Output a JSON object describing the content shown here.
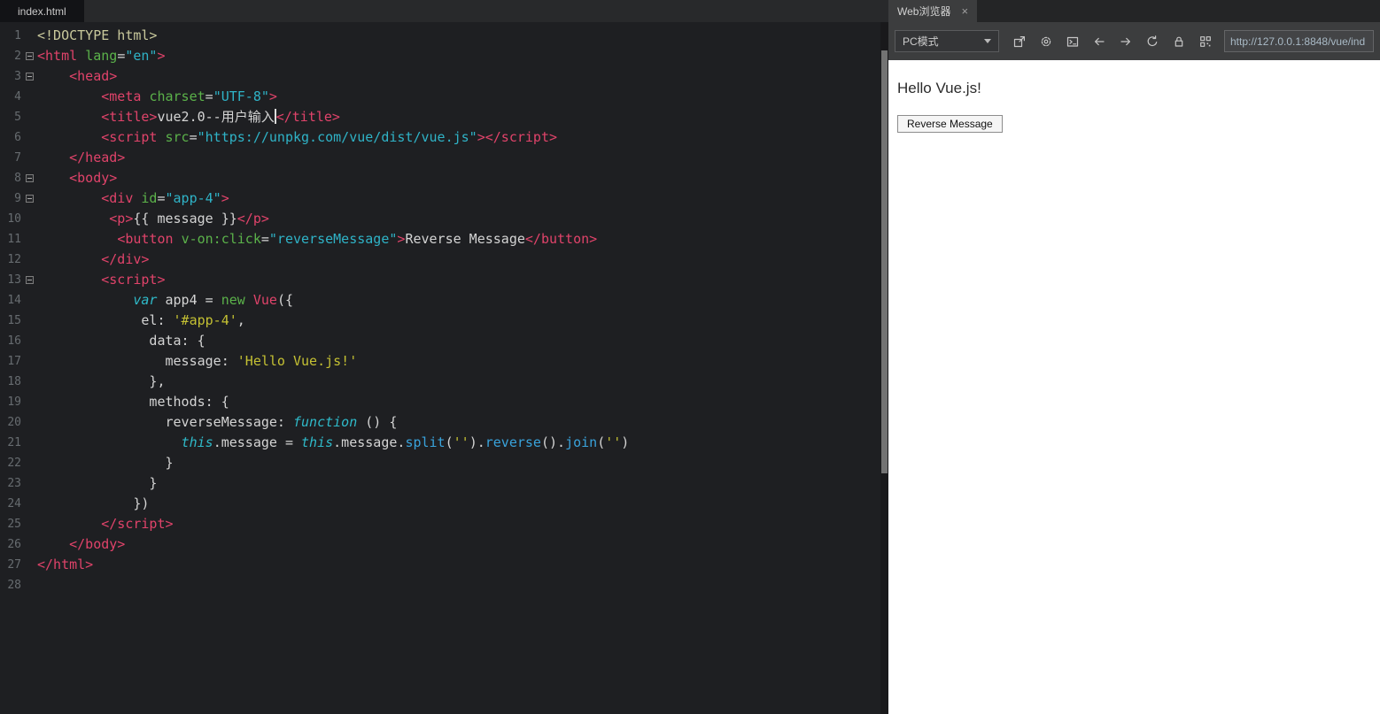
{
  "editor": {
    "tab_label": "index.html",
    "lines": [
      {
        "n": 1,
        "fold": false,
        "tokens": [
          [
            "d",
            "<!DOCTYPE html>"
          ]
        ]
      },
      {
        "n": 2,
        "fold": true,
        "tokens": [
          [
            "t",
            "<html"
          ],
          [
            "p",
            " "
          ],
          [
            "a",
            "lang"
          ],
          [
            "p",
            "="
          ],
          [
            "v",
            "\"en\""
          ],
          [
            "t",
            ">"
          ]
        ]
      },
      {
        "n": 3,
        "fold": true,
        "tokens": [
          [
            "p",
            "    "
          ],
          [
            "t",
            "<head>"
          ]
        ]
      },
      {
        "n": 4,
        "fold": false,
        "tokens": [
          [
            "p",
            "        "
          ],
          [
            "t",
            "<meta"
          ],
          [
            "p",
            " "
          ],
          [
            "a",
            "charset"
          ],
          [
            "p",
            "="
          ],
          [
            "v",
            "\"UTF-8\""
          ],
          [
            "t",
            ">"
          ]
        ]
      },
      {
        "n": 5,
        "fold": false,
        "tokens": [
          [
            "p",
            "        "
          ],
          [
            "t",
            "<title>"
          ],
          [
            "p",
            "vue2.0--用户输入"
          ],
          [
            "c",
            ""
          ],
          [
            "t",
            "</title>"
          ]
        ]
      },
      {
        "n": 6,
        "fold": false,
        "tokens": [
          [
            "p",
            "        "
          ],
          [
            "t",
            "<script"
          ],
          [
            "p",
            " "
          ],
          [
            "a",
            "src"
          ],
          [
            "p",
            "="
          ],
          [
            "v",
            "\"https://unpkg.com/vue/dist/vue.js\""
          ],
          [
            "t",
            "></script>"
          ]
        ]
      },
      {
        "n": 7,
        "fold": false,
        "tokens": [
          [
            "p",
            "    "
          ],
          [
            "t",
            "</head>"
          ]
        ]
      },
      {
        "n": 8,
        "fold": true,
        "tokens": [
          [
            "p",
            "    "
          ],
          [
            "t",
            "<body>"
          ]
        ]
      },
      {
        "n": 9,
        "fold": true,
        "tokens": [
          [
            "p",
            "        "
          ],
          [
            "t",
            "<div"
          ],
          [
            "p",
            " "
          ],
          [
            "a",
            "id"
          ],
          [
            "p",
            "="
          ],
          [
            "v",
            "\"app-4\""
          ],
          [
            "t",
            ">"
          ]
        ]
      },
      {
        "n": 10,
        "fold": false,
        "tokens": [
          [
            "p",
            "         "
          ],
          [
            "t",
            "<p>"
          ],
          [
            "p",
            "{{ message }}"
          ],
          [
            "t",
            "</p>"
          ]
        ]
      },
      {
        "n": 11,
        "fold": false,
        "tokens": [
          [
            "p",
            "          "
          ],
          [
            "t",
            "<button"
          ],
          [
            "p",
            " "
          ],
          [
            "a",
            "v-on:click"
          ],
          [
            "p",
            "="
          ],
          [
            "v",
            "\"reverseMessage\""
          ],
          [
            "t",
            ">"
          ],
          [
            "p",
            "Reverse Message"
          ],
          [
            "t",
            "</button>"
          ]
        ]
      },
      {
        "n": 12,
        "fold": false,
        "tokens": [
          [
            "p",
            "        "
          ],
          [
            "t",
            "</div>"
          ]
        ]
      },
      {
        "n": 13,
        "fold": true,
        "tokens": [
          [
            "p",
            "        "
          ],
          [
            "t",
            "<script>"
          ]
        ]
      },
      {
        "n": 14,
        "fold": false,
        "tokens": [
          [
            "p",
            "            "
          ],
          [
            "k",
            "var"
          ],
          [
            "p",
            " app4 = "
          ],
          [
            "n",
            "new"
          ],
          [
            "p",
            " "
          ],
          [
            "t",
            "Vue"
          ],
          [
            "p",
            "({"
          ]
        ]
      },
      {
        "n": 15,
        "fold": false,
        "tokens": [
          [
            "p",
            "             el: "
          ],
          [
            "s",
            "'#app-4'"
          ],
          [
            "p",
            ","
          ]
        ]
      },
      {
        "n": 16,
        "fold": false,
        "tokens": [
          [
            "p",
            "              data: {"
          ]
        ]
      },
      {
        "n": 17,
        "fold": false,
        "tokens": [
          [
            "p",
            "                message: "
          ],
          [
            "s",
            "'Hello Vue.js!'"
          ]
        ]
      },
      {
        "n": 18,
        "fold": false,
        "tokens": [
          [
            "p",
            "              },"
          ]
        ]
      },
      {
        "n": 19,
        "fold": false,
        "tokens": [
          [
            "p",
            "              methods: {"
          ]
        ]
      },
      {
        "n": 20,
        "fold": false,
        "tokens": [
          [
            "p",
            "                reverseMessage: "
          ],
          [
            "k",
            "function"
          ],
          [
            "p",
            " () {"
          ]
        ]
      },
      {
        "n": 21,
        "fold": false,
        "tokens": [
          [
            "p",
            "                  "
          ],
          [
            "k",
            "this"
          ],
          [
            "p",
            ".message = "
          ],
          [
            "k",
            "this"
          ],
          [
            "p",
            ".message."
          ],
          [
            "f",
            "split"
          ],
          [
            "p",
            "("
          ],
          [
            "s",
            "''"
          ],
          [
            "p",
            ")."
          ],
          [
            "f",
            "reverse"
          ],
          [
            "p",
            "()."
          ],
          [
            "f",
            "join"
          ],
          [
            "p",
            "("
          ],
          [
            "s",
            "''"
          ],
          [
            "p",
            ")"
          ]
        ]
      },
      {
        "n": 22,
        "fold": false,
        "tokens": [
          [
            "p",
            "                }"
          ]
        ]
      },
      {
        "n": 23,
        "fold": false,
        "tokens": [
          [
            "p",
            "              }"
          ]
        ]
      },
      {
        "n": 24,
        "fold": false,
        "tokens": [
          [
            "p",
            "            })"
          ]
        ]
      },
      {
        "n": 25,
        "fold": false,
        "tokens": [
          [
            "p",
            "        "
          ],
          [
            "t",
            "</script>"
          ]
        ]
      },
      {
        "n": 26,
        "fold": false,
        "tokens": [
          [
            "p",
            "    "
          ],
          [
            "t",
            "</body>"
          ]
        ]
      },
      {
        "n": 27,
        "fold": false,
        "tokens": [
          [
            "t",
            "</html>"
          ]
        ]
      },
      {
        "n": 28,
        "fold": false,
        "tokens": []
      }
    ]
  },
  "browser": {
    "tab_label": "Web浏览器",
    "close_glyph": "×",
    "mode_label": "PC模式",
    "toolbar_icons": [
      "popout-icon",
      "settings-gear-icon",
      "console-icon",
      "back-icon",
      "forward-icon",
      "refresh-icon",
      "lock-icon",
      "qrcode-icon"
    ],
    "url": "http://127.0.0.1:8848/vue/ind",
    "page": {
      "heading": "Hello Vue.js!",
      "button_label": "Reverse Message"
    }
  }
}
